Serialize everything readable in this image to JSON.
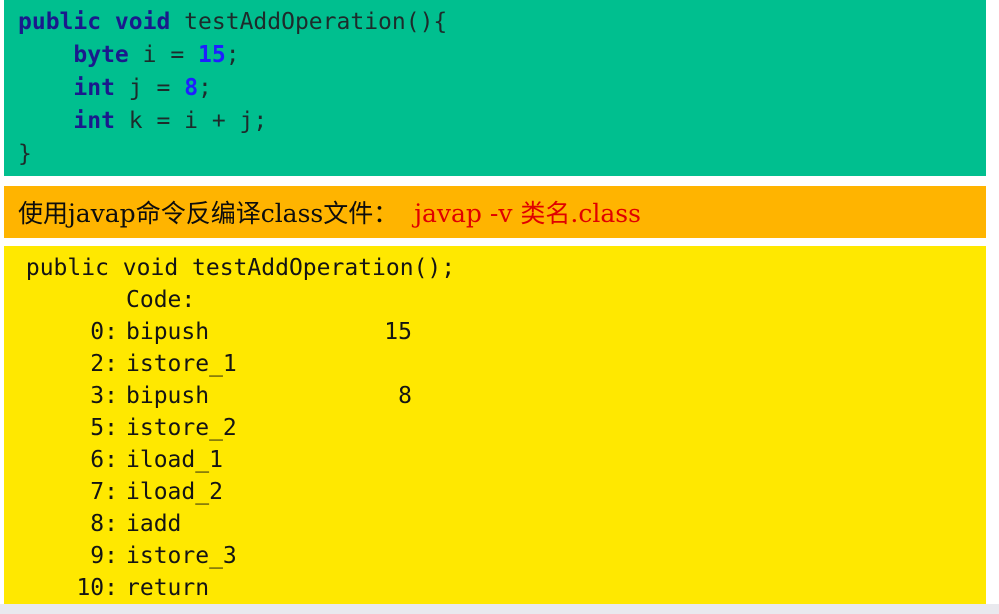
{
  "source_block": {
    "background_color": "#00bf8f",
    "keyword_color": "#1a1a8c",
    "number_color": "#1f1fff",
    "text_color": "#1d2b2b",
    "lines": [
      {
        "indent": "",
        "keyword": "public void",
        "rest": " testAddOperation(){",
        "number": ""
      },
      {
        "indent": "    ",
        "keyword": "byte",
        "rest": " i = ",
        "number": "15",
        "tail": ";"
      },
      {
        "indent": "    ",
        "keyword": "int",
        "rest": " j = ",
        "number": "8",
        "tail": ";"
      },
      {
        "indent": "    ",
        "keyword": "int",
        "rest": " k = i + j;",
        "number": ""
      },
      {
        "indent": "",
        "keyword": "",
        "rest": "}",
        "number": ""
      }
    ],
    "line1_keyword": "public void",
    "line1_rest": " testAddOperation(){",
    "line2_indent": "    ",
    "line2_keyword": "byte",
    "line2_mid": " i = ",
    "line2_number": "15",
    "line2_tail": ";",
    "line3_indent": "    ",
    "line3_keyword": "int",
    "line3_mid": " j = ",
    "line3_number": "8",
    "line3_tail": ";",
    "line4_indent": "    ",
    "line4_keyword": "int",
    "line4_rest": " k = i + j;",
    "line5": "}"
  },
  "caption_banner": {
    "background_color": "#ffb400",
    "text_color": "#0d0d0d",
    "command_color": "#e00000",
    "label": "使用javap命令反编译class文件：",
    "command": "javap -v 类名.class"
  },
  "bytecode_block": {
    "background_color": "#ffe800",
    "text_color": "#141414",
    "signature": " public void testAddOperation();",
    "code_label": "Code:",
    "instructions": [
      {
        "pc": "0:",
        "mnemonic": "bipush",
        "operand": "15"
      },
      {
        "pc": "2:",
        "mnemonic": "istore_1",
        "operand": ""
      },
      {
        "pc": "3:",
        "mnemonic": "bipush",
        "operand": "8"
      },
      {
        "pc": "5:",
        "mnemonic": "istore_2",
        "operand": ""
      },
      {
        "pc": "6:",
        "mnemonic": "iload_1",
        "operand": ""
      },
      {
        "pc": "7:",
        "mnemonic": "iload_2",
        "operand": ""
      },
      {
        "pc": "8:",
        "mnemonic": "iadd",
        "operand": ""
      },
      {
        "pc": "9:",
        "mnemonic": "istore_3",
        "operand": ""
      },
      {
        "pc": "10:",
        "mnemonic": "return",
        "operand": ""
      }
    ]
  }
}
